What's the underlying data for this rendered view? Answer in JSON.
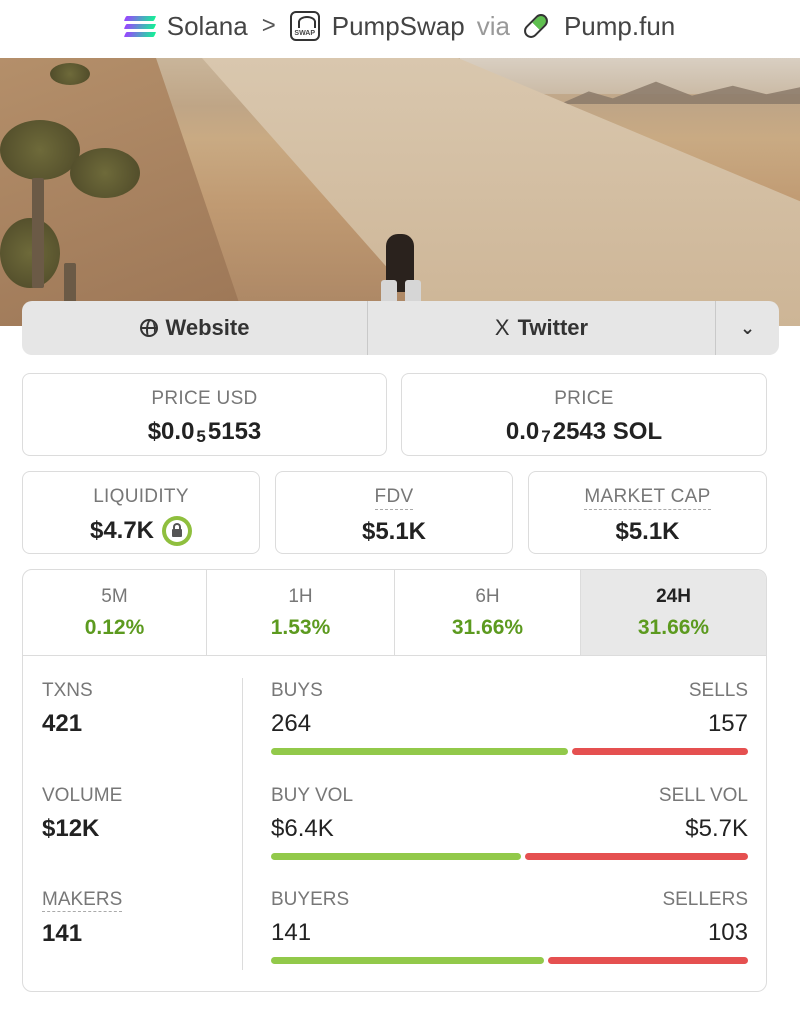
{
  "breadcrumb": {
    "chain": "Solana",
    "separator": ">",
    "dex": "PumpSwap",
    "via": "via",
    "launchpad": "Pump.fun",
    "swap_icon_text": "SWAP"
  },
  "links": {
    "website": "Website",
    "twitter": "Twitter",
    "twitter_glyph": "X",
    "more_glyph": "⌄"
  },
  "price_usd": {
    "label": "PRICE USD",
    "prefix": "$0.0",
    "zeros": "5",
    "digits": "5153"
  },
  "price_native": {
    "label": "PRICE",
    "prefix": "0.0",
    "zeros": "7",
    "digits": "2543 SOL"
  },
  "liquidity": {
    "label": "LIQUIDITY",
    "value": "$4.7K",
    "locked": true
  },
  "fdv": {
    "label": "FDV",
    "value": "$5.1K"
  },
  "market_cap": {
    "label": "MARKET CAP",
    "value": "$5.1K"
  },
  "timeframes": [
    {
      "label": "5M",
      "change": "0.12%"
    },
    {
      "label": "1H",
      "change": "1.53%"
    },
    {
      "label": "6H",
      "change": "31.66%"
    },
    {
      "label": "24H",
      "change": "31.66%",
      "selected": true
    }
  ],
  "txns": {
    "label": "TXNS",
    "value": "421",
    "buys_label": "BUYS",
    "buys": "264",
    "sells_label": "SELLS",
    "sells": "157",
    "buy_fraction": 0.627
  },
  "volume": {
    "label": "VOLUME",
    "value": "$12K",
    "buy_label": "BUY VOL",
    "buy": "$6.4K",
    "sell_label": "SELL VOL",
    "sell": "$5.7K",
    "buy_fraction": 0.529
  },
  "makers": {
    "label": "MAKERS",
    "value": "141",
    "buyers_label": "BUYERS",
    "buyers": "141",
    "sellers_label": "SELLERS",
    "sellers": "103",
    "buy_fraction": 0.578
  },
  "colors": {
    "positive": "#5c9a1f",
    "buy_bar": "#92c94a",
    "sell_bar": "#e55050",
    "lock_ring": "#8fbf3e"
  }
}
